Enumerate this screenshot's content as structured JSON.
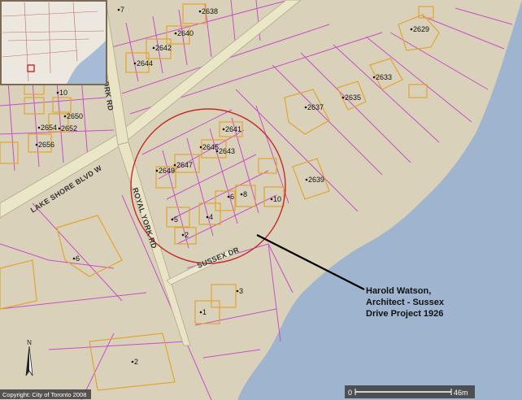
{
  "colors": {
    "land": "#d9d1b9",
    "water": "#9db3cf",
    "property_line": "#c64bc6",
    "building": "#e2a433",
    "road": "#eae6c8",
    "circle": "#c52b2b"
  },
  "streets": {
    "lake_shore": "LAKE SHORE BLVD W",
    "royal_york": "ROYAL YORK RD",
    "royal_york_north": "ORK RD",
    "sussex": "SUSSEX DR"
  },
  "addresses": [
    {
      "label": "2638"
    },
    {
      "label": "2640"
    },
    {
      "label": "2642"
    },
    {
      "label": "2644"
    },
    {
      "label": "2629"
    },
    {
      "label": "2633"
    },
    {
      "label": "2635"
    },
    {
      "label": "2637"
    },
    {
      "label": "2639"
    },
    {
      "label": "2641"
    },
    {
      "label": "2643"
    },
    {
      "label": "2645"
    },
    {
      "label": "2647"
    },
    {
      "label": "2649"
    },
    {
      "label": "2650"
    },
    {
      "label": "2652"
    },
    {
      "label": "2654"
    },
    {
      "label": "2656"
    },
    {
      "label": "10"
    },
    {
      "label": "8"
    },
    {
      "label": "6"
    },
    {
      "label": "4"
    },
    {
      "label": "5"
    },
    {
      "label": "2"
    },
    {
      "label": "3"
    },
    {
      "label": "1"
    },
    {
      "label": "6"
    },
    {
      "label": "2"
    },
    {
      "label": "10"
    },
    {
      "label": "7"
    }
  ],
  "callout": {
    "line1": "Harold Watson,",
    "line2": "Architect - Sussex",
    "line3": "Drive Project 1926"
  },
  "copyright": "Copyright: City of Toronto 2008",
  "scale": {
    "start": "0",
    "end": "46m"
  },
  "overview_map": {
    "icon": "locator-map"
  },
  "north_arrow": {
    "letter": "N"
  }
}
